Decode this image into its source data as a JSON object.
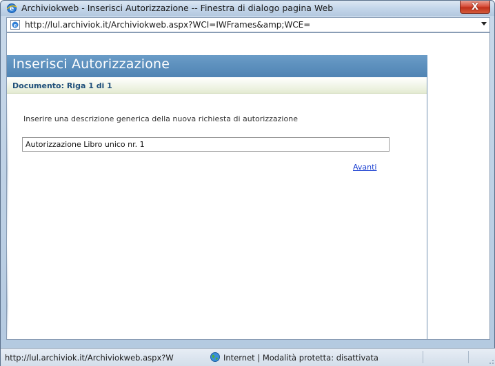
{
  "window": {
    "title": "Archiviokweb - Inserisci Autorizzazione -- Finestra di dialogo pagina Web",
    "close_label": "X"
  },
  "address": {
    "url": "http://lul.archiviok.it/Archiviokweb.aspx?WCI=IWFrames&amp;WCE="
  },
  "page": {
    "title": "Inserisci Autorizzazione",
    "subheader": "Documento: Riga 1 di 1",
    "description": "Inserire una descrizione generica della nuova richiesta di autorizzazione",
    "input_value": "Autorizzazione Libro unico nr. 1",
    "next_link": "Avanti"
  },
  "status": {
    "url": "http://lul.archiviok.it/Archiviokweb.aspx?W",
    "zone": "Internet | Modalità protetta: disattivata"
  },
  "colors": {
    "header_band": "#4f83b3",
    "link": "#1a3fd1",
    "subheader_text": "#1f4f7a"
  }
}
